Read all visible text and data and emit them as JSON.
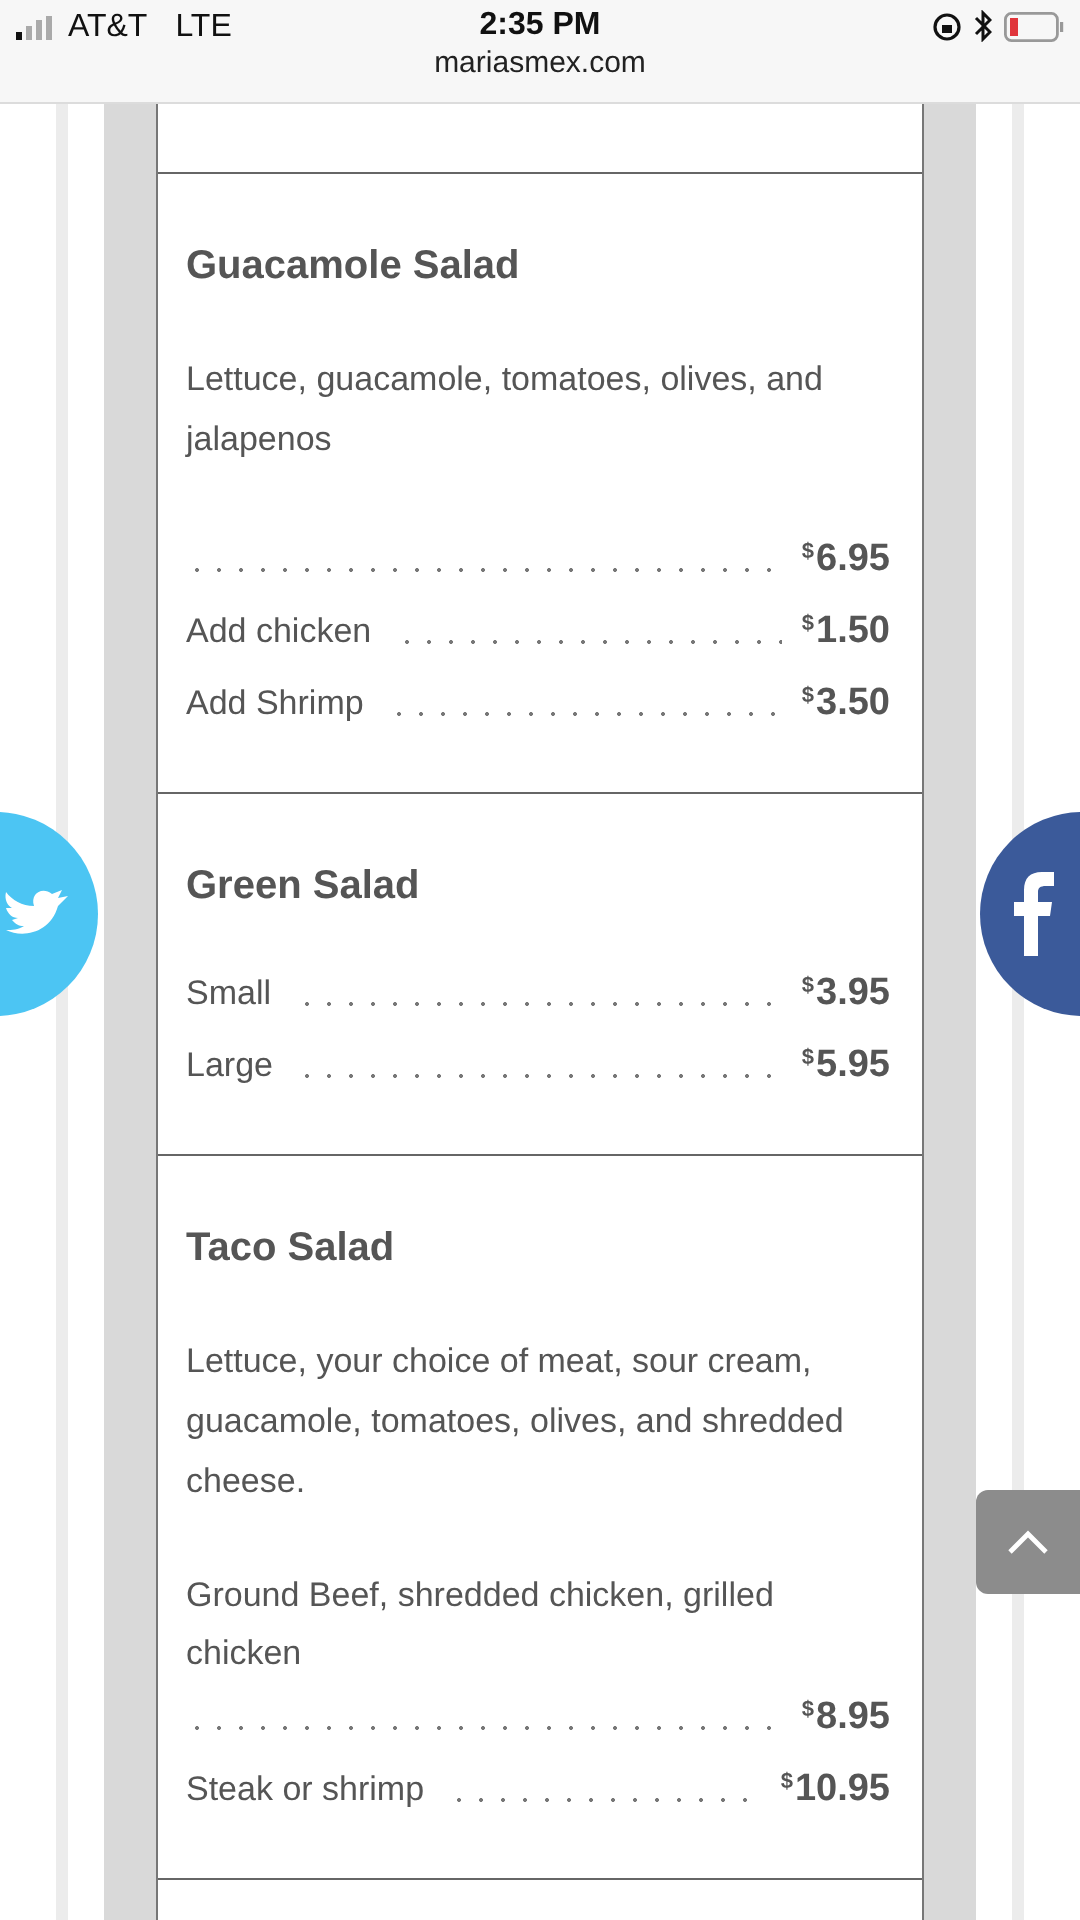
{
  "status_bar": {
    "carrier": "AT&T",
    "network": "LTE",
    "time": "2:35 PM",
    "url": "mariasmex.com"
  },
  "menu_items": [
    {
      "title": "Guacamole Salad",
      "lines": [
        {
          "kind": "description",
          "text": "Lettuce, guacamole, tomatoes, olives, and jalapenos"
        },
        {
          "kind": "price",
          "currency": "$",
          "amount": "6.95"
        },
        {
          "kind": "price",
          "label": "Add chicken",
          "currency": "$",
          "amount": "1.50"
        },
        {
          "kind": "price",
          "label": "Add Shrimp",
          "currency": "$",
          "amount": "3.50"
        }
      ]
    },
    {
      "title": "Green Salad",
      "lines": [
        {
          "kind": "price",
          "label": "Small",
          "currency": "$",
          "amount": "3.95"
        },
        {
          "kind": "price",
          "label": "Large",
          "currency": "$",
          "amount": "5.95"
        }
      ]
    },
    {
      "title": "Taco Salad",
      "lines": [
        {
          "kind": "description",
          "text": "Lettuce, your choice of meat, sour cream, guacamole, tomatoes, olives, and shredded cheese."
        },
        {
          "kind": "note",
          "text": "Ground Beef, shredded chicken, grilled chicken"
        },
        {
          "kind": "price",
          "currency": "$",
          "amount": "8.95"
        },
        {
          "kind": "price",
          "label": "Steak or shrimp",
          "currency": "$",
          "amount": "10.95"
        }
      ]
    }
  ]
}
